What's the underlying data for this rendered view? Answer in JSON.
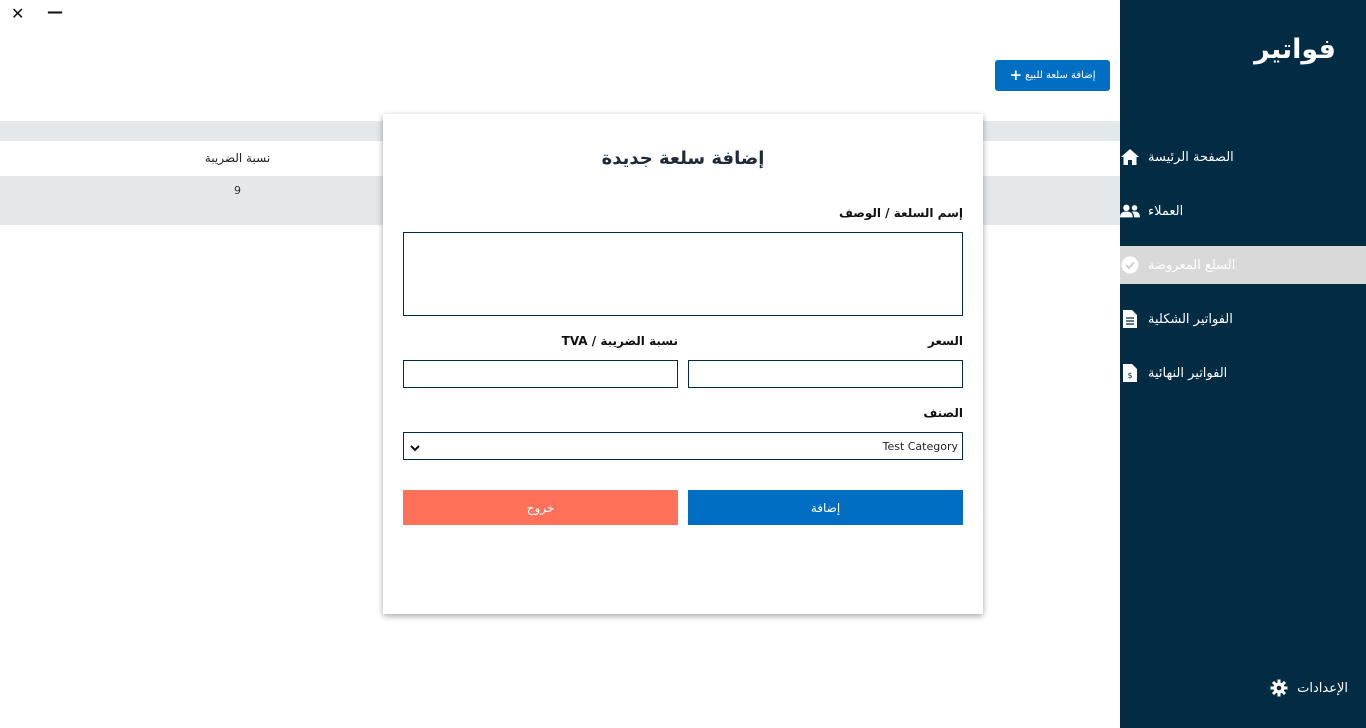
{
  "window": {
    "close_glyph": "✕",
    "minimize_glyph": "—"
  },
  "sidebar": {
    "brand": "فواتير",
    "items": [
      {
        "label": "الصفحة الرئيسة",
        "icon": "home-icon",
        "active": false
      },
      {
        "label": "العملاء",
        "icon": "users-icon",
        "active": false
      },
      {
        "label": "السلع المعروضة",
        "icon": "check-circle-icon",
        "active": true
      },
      {
        "label": "الفواتير الشكلية",
        "icon": "document-icon",
        "active": false
      },
      {
        "label": "الفواتير النهائية",
        "icon": "invoice-icon",
        "active": false
      }
    ],
    "settings_label": "الإعدادات"
  },
  "toolbar": {
    "add_item_label": "إضافة سلعة للبيع",
    "plus_glyph": "+"
  },
  "table": {
    "columns": [
      "نسبة الضريبة"
    ],
    "rows": [
      [
        "9"
      ]
    ]
  },
  "modal": {
    "title": "إضافة سلعة جديدة",
    "name_label": "إسم السلعة / الوصف",
    "name_value": "",
    "price_label": "السعر",
    "price_value": "",
    "tax_label": "نسبة الضريبة / TVA",
    "tax_value": "",
    "category_label": "الصنف",
    "category_value": "Test Category",
    "submit_label": "إضافة",
    "exit_label": "خروج"
  },
  "colors": {
    "sidebar_bg": "#022c43",
    "primary": "#006ec2",
    "danger": "#ff7158",
    "active_item_bg": "#d9d9d9",
    "table_stripe": "#e4e8ea"
  }
}
